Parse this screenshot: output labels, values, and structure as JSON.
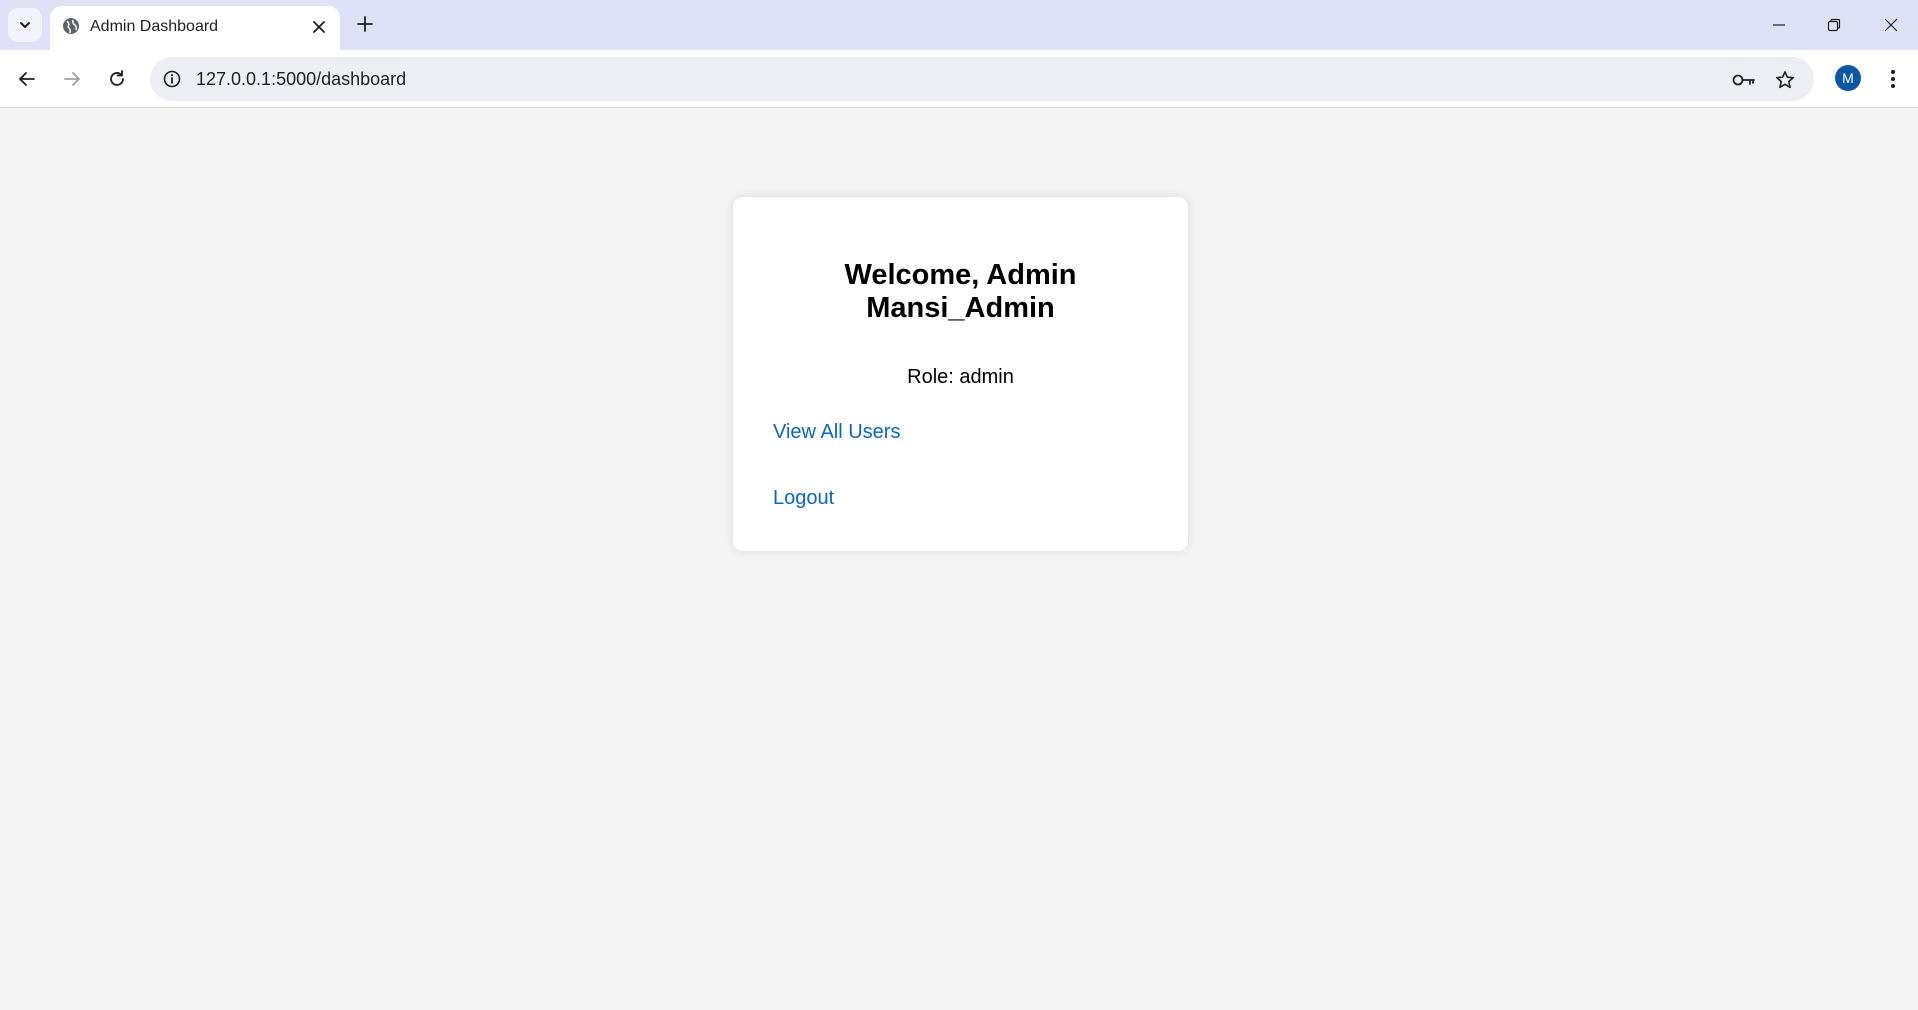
{
  "browser": {
    "tab": {
      "title": "Admin Dashboard",
      "favicon": "globe-icon"
    },
    "address_bar": {
      "url": "127.0.0.1:5000/dashboard"
    },
    "profile_initial": "M",
    "profile_color": "#0b57a4",
    "tabstrip_color": "#dfe1f7"
  },
  "page": {
    "background": "#f3f3f3",
    "heading": "Welcome, Admin Mansi_Admin",
    "role_text": "Role: admin",
    "links": {
      "view_all_users": "View All Users",
      "logout": "Logout"
    },
    "link_color": "#0a66c2"
  }
}
